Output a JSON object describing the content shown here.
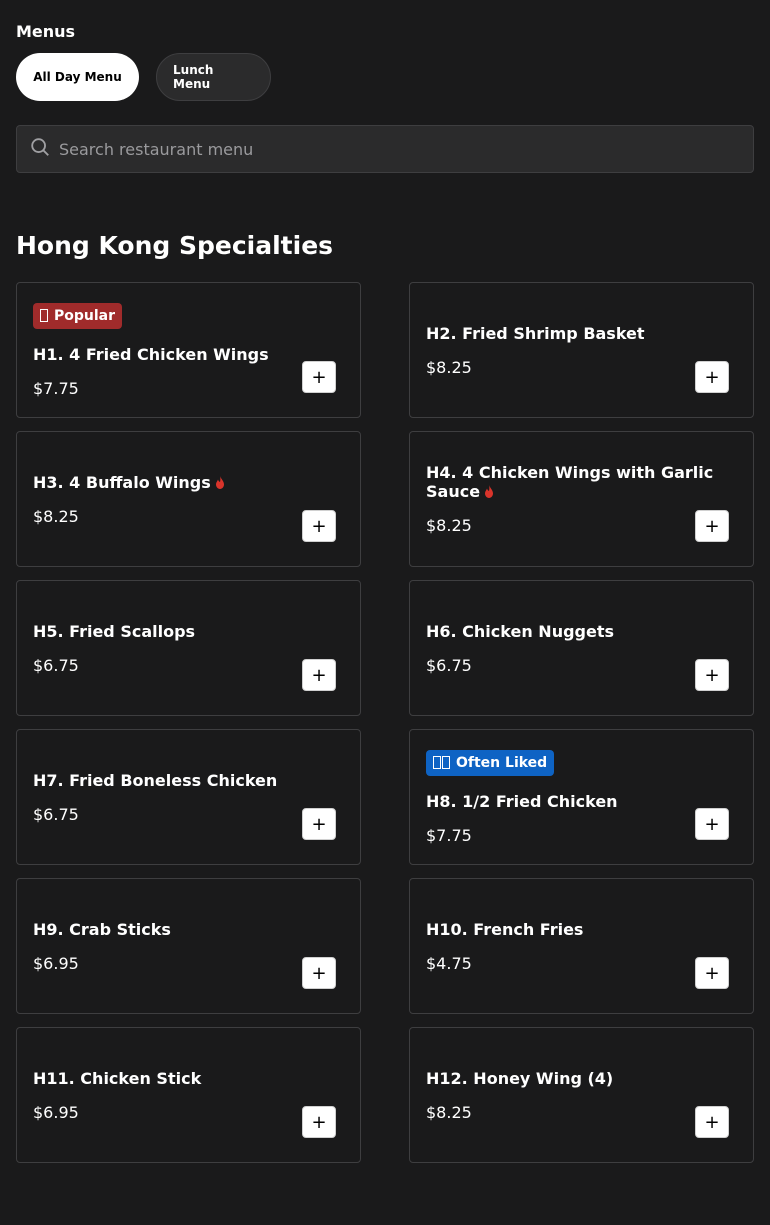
{
  "header": {
    "title": "Menus"
  },
  "tabs": [
    {
      "label": "All Day Menu",
      "active": true
    },
    {
      "label": "Lunch Menu",
      "active": false
    }
  ],
  "search": {
    "placeholder": "Search restaurant menu",
    "value": ""
  },
  "section": {
    "title": "Hong Kong Specialties"
  },
  "colors": {
    "popular_badge": "#a02b2b",
    "liked_badge": "#0e63c4",
    "spicy": "#d9342b",
    "background": "#1a1a1b"
  },
  "items": [
    {
      "name": "H1. 4 Fried Chicken Wings",
      "price": "$7.75",
      "badge": "Popular",
      "badge_icon": "fire-icon",
      "spicy": false,
      "add_label": "+"
    },
    {
      "name": "H2. Fried Shrimp Basket",
      "price": "$8.25",
      "badge": "",
      "spicy": false,
      "add_label": "+"
    },
    {
      "name": "H3. 4 Buffalo Wings",
      "price": "$8.25",
      "badge": "",
      "spicy": true,
      "add_label": "+"
    },
    {
      "name": "H4. 4 Chicken Wings with Garlic Sauce",
      "price": "$8.25",
      "badge": "",
      "spicy": true,
      "add_label": "+"
    },
    {
      "name": "H5. Fried Scallops",
      "price": "$6.75",
      "badge": "",
      "spicy": false,
      "add_label": "+"
    },
    {
      "name": "H6. Chicken Nuggets",
      "price": "$6.75",
      "badge": "",
      "spicy": false,
      "add_label": "+"
    },
    {
      "name": "H7. Fried Boneless Chicken",
      "price": "$6.75",
      "badge": "",
      "spicy": false,
      "add_label": "+"
    },
    {
      "name": "H8. 1/2 Fried Chicken",
      "price": "$7.75",
      "badge": "Often Liked",
      "badge_icon": "thumbs-up-icon",
      "spicy": false,
      "add_label": "+"
    },
    {
      "name": "H9. Crab Sticks",
      "price": "$6.95",
      "badge": "",
      "spicy": false,
      "add_label": "+"
    },
    {
      "name": "H10. French Fries",
      "price": "$4.75",
      "badge": "",
      "spicy": false,
      "add_label": "+"
    },
    {
      "name": "H11. Chicken Stick",
      "price": "$6.95",
      "badge": "",
      "spicy": false,
      "add_label": "+"
    },
    {
      "name": "H12. Honey Wing (4)",
      "price": "$8.25",
      "badge": "",
      "spicy": false,
      "add_label": "+"
    }
  ]
}
